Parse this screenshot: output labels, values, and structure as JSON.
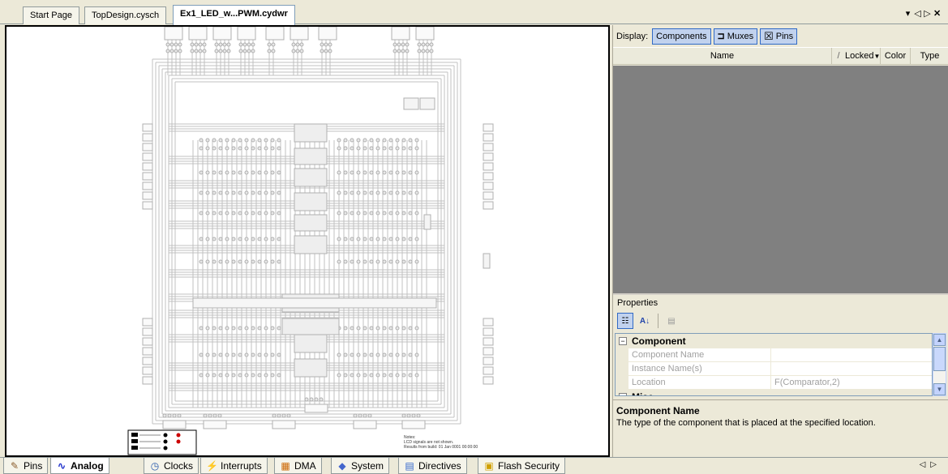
{
  "tabs": [
    {
      "label": "Start Page",
      "active": false
    },
    {
      "label": "TopDesign.cysch",
      "active": false
    },
    {
      "label": "Ex1_LED_w...PWM.cydwr",
      "active": true
    }
  ],
  "tab_controls": {
    "dropdown": "▾",
    "prev": "◁",
    "next": "▷",
    "close": "✕"
  },
  "canvas": {
    "notes_title": "Notes:",
    "notes_line1": "LCD signals are not shown.",
    "notes_line2": "Results from build: 01 Jan 0001 00:00:00"
  },
  "display": {
    "label": "Display:",
    "components_label": "Components",
    "muxes_label": "Muxes",
    "pins_label": "Pins"
  },
  "grid": {
    "columns": [
      "Name",
      "/",
      "Locked",
      "Color",
      "Type"
    ]
  },
  "properties": {
    "title": "Properties",
    "categories": [
      {
        "label": "Component",
        "rows": [
          {
            "name": "Component Name",
            "value": ""
          },
          {
            "name": "Instance Name(s)",
            "value": ""
          },
          {
            "name": "Location",
            "value": "F(Comparator,2)"
          }
        ]
      },
      {
        "label": "Misc"
      }
    ],
    "desc_title": "Component Name",
    "desc_text": "The type of the component that is placed at the specified location."
  },
  "bottom_tabs": [
    {
      "label": "Pins",
      "icon": "pins-icon",
      "glyph": "✎",
      "color": "#8a5c2c",
      "active": false
    },
    {
      "label": "Analog",
      "icon": "analog-icon",
      "glyph": "∿",
      "color": "#2233cc",
      "active": true
    },
    {
      "label": "Clocks",
      "icon": "clock-icon",
      "glyph": "◷",
      "color": "#2255aa",
      "active": false
    },
    {
      "label": "Interrupts",
      "icon": "interrupt-icon",
      "glyph": "⚡",
      "color": "#c8a000",
      "active": false
    },
    {
      "label": "DMA",
      "icon": "dma-icon",
      "glyph": "▦",
      "color": "#cc6600",
      "active": false
    },
    {
      "label": "System",
      "icon": "system-icon",
      "glyph": "◆",
      "color": "#4466cc",
      "active": false
    },
    {
      "label": "Directives",
      "icon": "directives-icon",
      "glyph": "▤",
      "color": "#3366cc",
      "active": false
    },
    {
      "label": "Flash Security",
      "icon": "flash-security-icon",
      "glyph": "▣",
      "color": "#d0a000",
      "active": false
    }
  ],
  "bottom_controls": {
    "prev": "◁",
    "next": "▷"
  }
}
